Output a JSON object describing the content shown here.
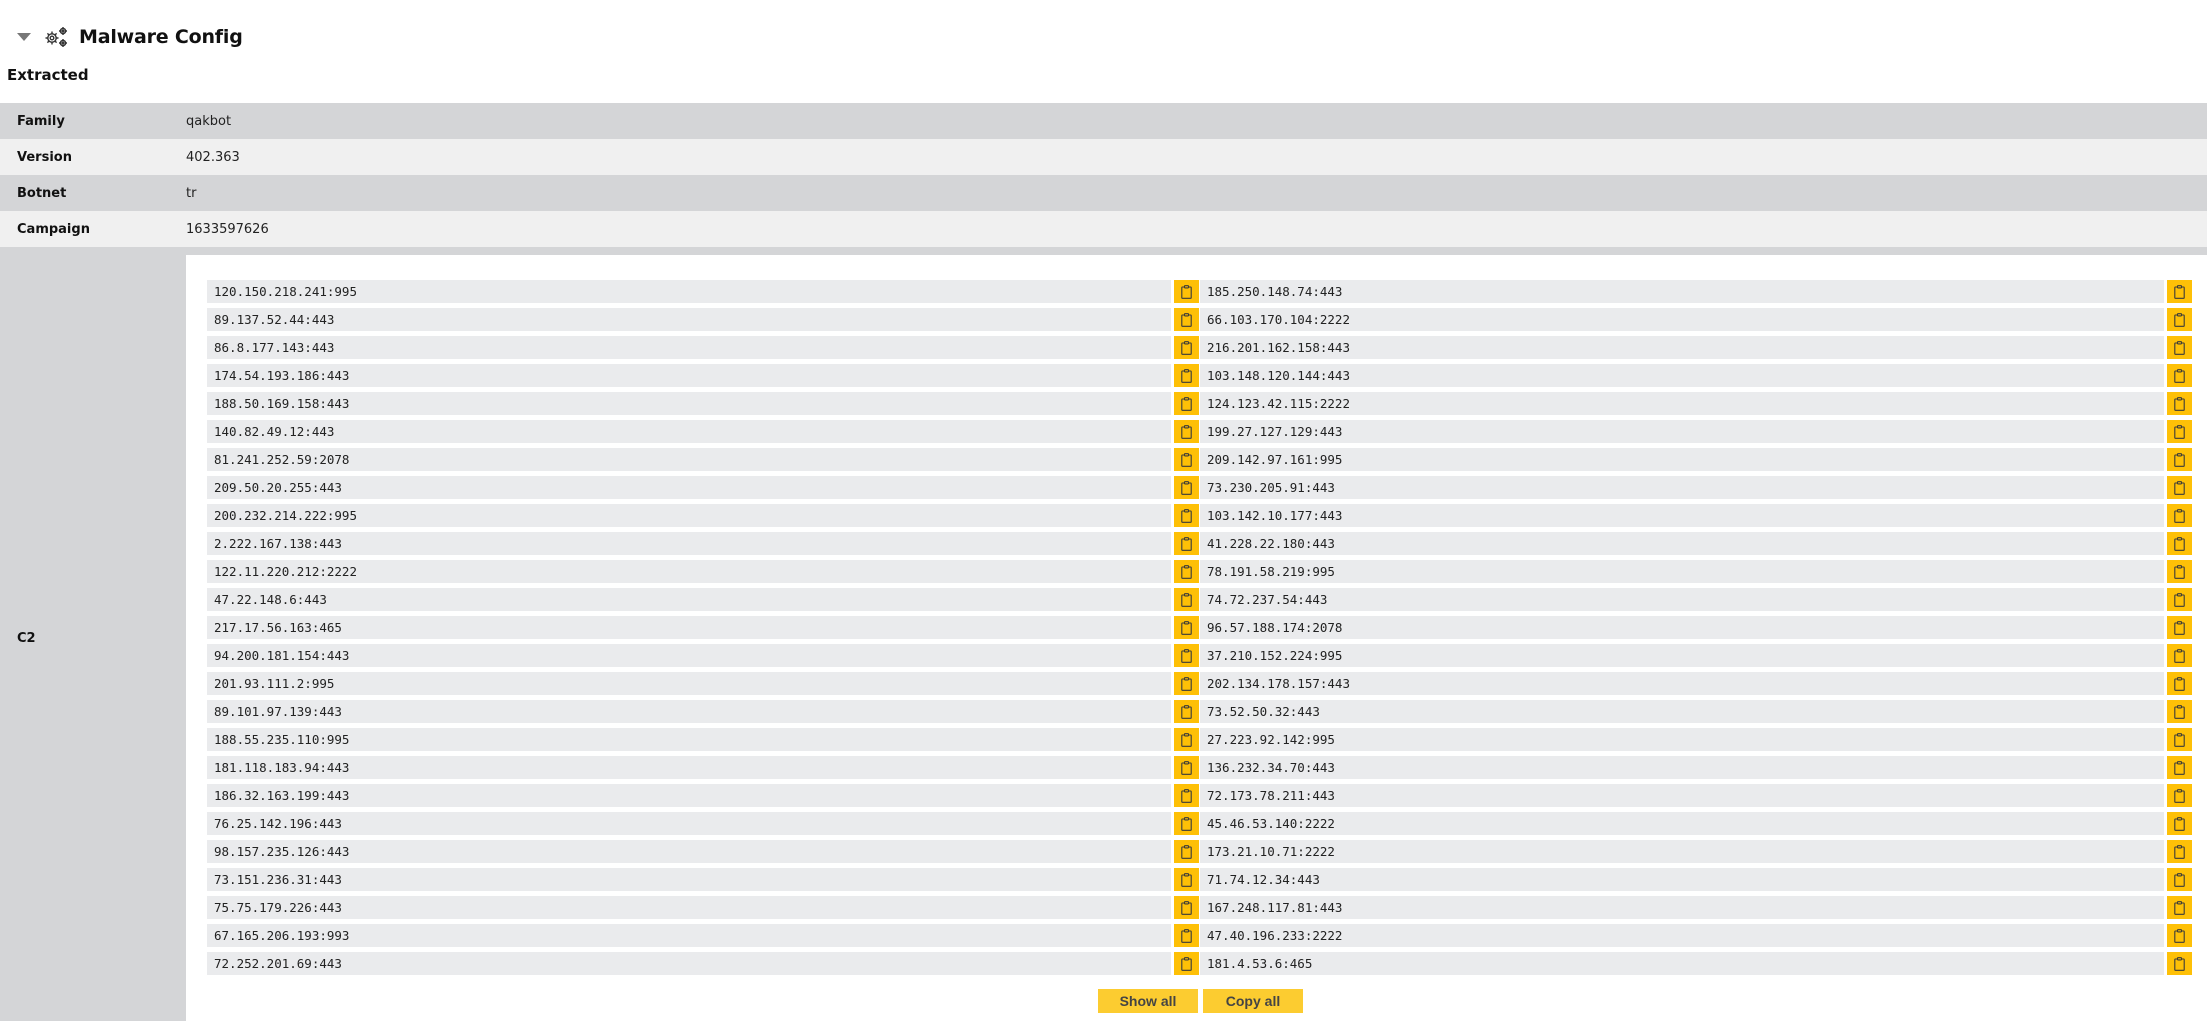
{
  "header": {
    "title": "Malware Config",
    "icon": "gears-icon",
    "toggle_icon": "caret-down-icon"
  },
  "subtitle": "Extracted",
  "fields": [
    {
      "key": "Family",
      "value": "qakbot"
    },
    {
      "key": "Version",
      "value": "402.363"
    },
    {
      "key": "Botnet",
      "value": "tr"
    },
    {
      "key": "Campaign",
      "value": "1633597626"
    }
  ],
  "c2": {
    "label": "C2",
    "copy_icon": "clipboard-icon",
    "left": [
      "120.150.218.241:995",
      "89.137.52.44:443",
      "86.8.177.143:443",
      "174.54.193.186:443",
      "188.50.169.158:443",
      "140.82.49.12:443",
      "81.241.252.59:2078",
      "209.50.20.255:443",
      "200.232.214.222:995",
      "2.222.167.138:443",
      "122.11.220.212:2222",
      "47.22.148.6:443",
      "217.17.56.163:465",
      "94.200.181.154:443",
      "201.93.111.2:995",
      "89.101.97.139:443",
      "188.55.235.110:995",
      "181.118.183.94:443",
      "186.32.163.199:443",
      "76.25.142.196:443",
      "98.157.235.126:443",
      "73.151.236.31:443",
      "75.75.179.226:443",
      "67.165.206.193:993",
      "72.252.201.69:443"
    ],
    "right": [
      "185.250.148.74:443",
      "66.103.170.104:2222",
      "216.201.162.158:443",
      "103.148.120.144:443",
      "124.123.42.115:2222",
      "199.27.127.129:443",
      "209.142.97.161:995",
      "73.230.205.91:443",
      "103.142.10.177:443",
      "41.228.22.180:443",
      "78.191.58.219:995",
      "74.72.237.54:443",
      "96.57.188.174:2078",
      "37.210.152.224:995",
      "202.134.178.157:443",
      "73.52.50.32:443",
      "27.223.92.142:995",
      "136.232.34.70:443",
      "72.173.78.211:443",
      "45.46.53.140:2222",
      "173.21.10.71:2222",
      "71.74.12.34:443",
      "167.248.117.81:443",
      "47.40.196.233:2222",
      "181.4.53.6:465"
    ],
    "show_all_label": "Show all",
    "copy_all_label": "Copy all"
  },
  "colors": {
    "accent_yellow": "#fec007",
    "button_yellow": "#fccc30",
    "row_dark": "#d4d5d7",
    "row_light": "#f0f0f0",
    "item_bg": "#eaebed"
  }
}
